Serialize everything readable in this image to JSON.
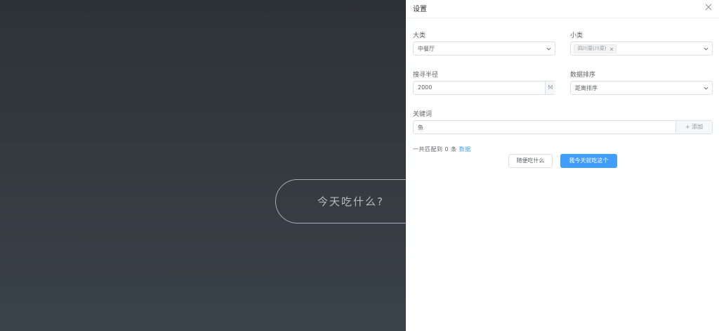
{
  "main": {
    "button_label": "今天吃什么?"
  },
  "drawer": {
    "title": "设置",
    "category": {
      "label": "大类",
      "value": "中餐厅"
    },
    "subcategory": {
      "label": "小类",
      "tags": [
        "四川菜(川菜)"
      ]
    },
    "radius": {
      "label": "搜寻半径",
      "value": "2000",
      "unit": "M"
    },
    "sort": {
      "label": "数据排序",
      "value": "距离排序"
    },
    "keyword": {
      "label": "关键词",
      "value": "鱼",
      "add_label": "+ 添加"
    },
    "stats": {
      "prefix": "一共匹配到",
      "count": "0",
      "unit": "条",
      "link": "数据"
    },
    "random_button": "随便吃什么",
    "confirm_button": "我今天就吃这个"
  }
}
